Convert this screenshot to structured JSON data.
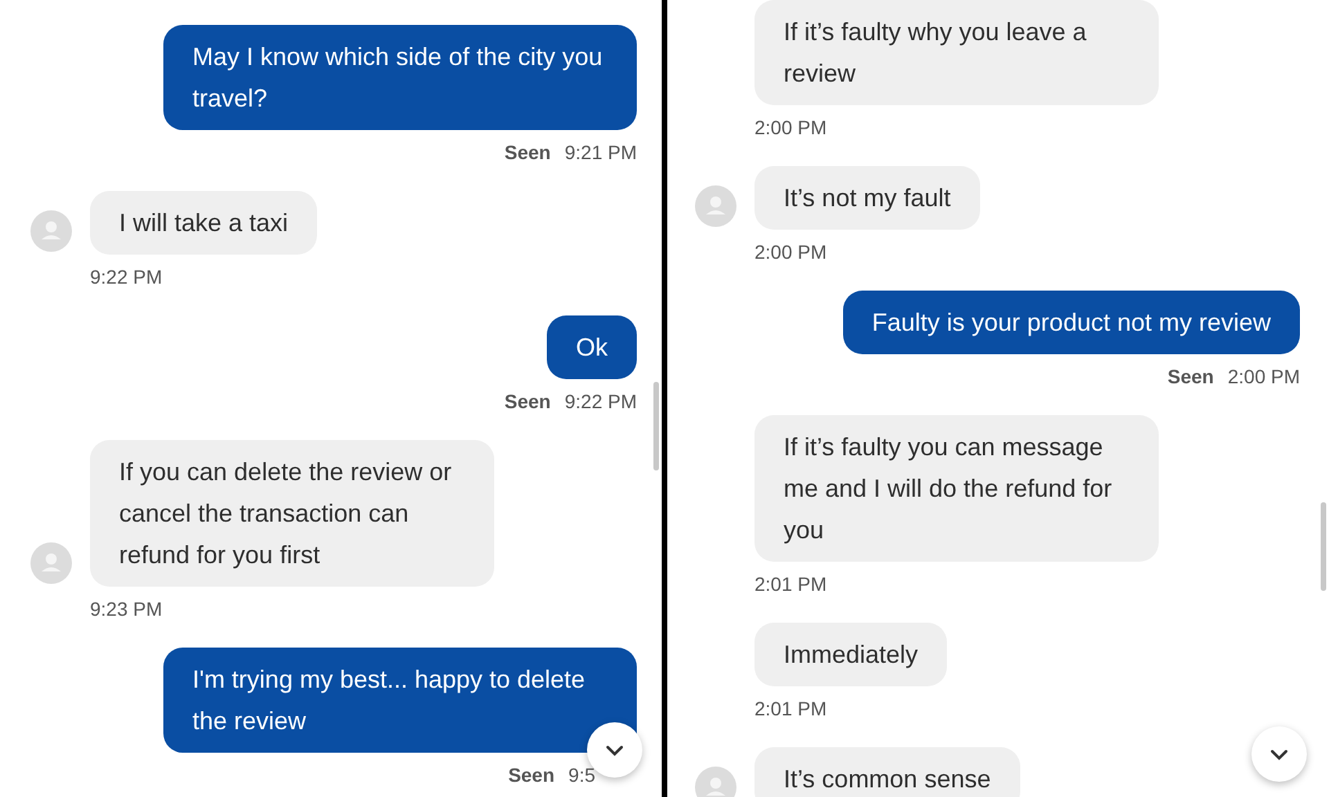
{
  "panels": [
    {
      "messages": [
        {
          "kind": "sent",
          "text": "May I know which side of the city you travel?",
          "status": "Seen",
          "time": "9:21 PM"
        },
        {
          "kind": "received",
          "text": "I will take a taxi",
          "avatar": true,
          "time": "9:22 PM"
        },
        {
          "kind": "sent",
          "text": "Ok",
          "status": "Seen",
          "time": "9:22 PM"
        },
        {
          "kind": "received",
          "text": "If you can delete the review or cancel the transaction can refund for you first",
          "avatar": true,
          "time": "9:23 PM"
        },
        {
          "kind": "sent",
          "text": "I'm trying my best... happy to delete the review",
          "status": "Seen",
          "time": "9:5"
        }
      ]
    },
    {
      "messages": [
        {
          "kind": "received",
          "text": "If it’s faulty why you leave a review",
          "avatar": false,
          "time": "2:00 PM"
        },
        {
          "kind": "received",
          "text": "It’s not my fault",
          "avatar": true,
          "time": "2:00 PM"
        },
        {
          "kind": "sent",
          "text": "Faulty is your product not my review",
          "status": "Seen",
          "time": "2:00 PM"
        },
        {
          "kind": "received",
          "text": "If it’s faulty you can message me and I will do the refund for you",
          "avatar": false,
          "time": "2:01 PM"
        },
        {
          "kind": "received",
          "text": "Immediately",
          "avatar": false,
          "time": "2:01 PM"
        },
        {
          "kind": "received",
          "text": "It’s common sense",
          "avatar": true
        }
      ]
    }
  ]
}
